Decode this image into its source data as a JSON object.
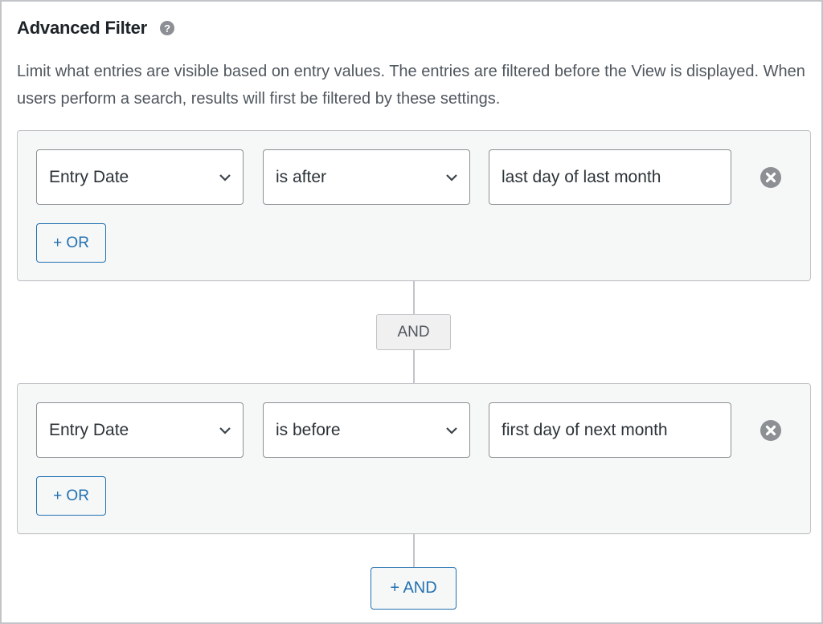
{
  "header": {
    "title": "Advanced Filter",
    "help_icon": "question-circle-icon",
    "help_glyph": "?"
  },
  "description": "Limit what entries are visible based on entry values. The entries are filtered before the View is displayed. When users perform a search, results will first be filtered by these settings.",
  "filter_groups": [
    {
      "field": "Entry Date",
      "operator": "is after",
      "value": "last day of last month",
      "remove_icon": "remove-circle-icon",
      "or_button": "+ OR"
    },
    {
      "field": "Entry Date",
      "operator": "is before",
      "value": "first day of next month",
      "remove_icon": "remove-circle-icon",
      "or_button": "+ OR"
    }
  ],
  "connector_label": "AND",
  "add_and_button": "+ AND",
  "colors": {
    "accent": "#2271b1",
    "panel_bg": "#f6f7f7",
    "border": "#c3c4c7",
    "remove_icon": "#8c8f94"
  }
}
